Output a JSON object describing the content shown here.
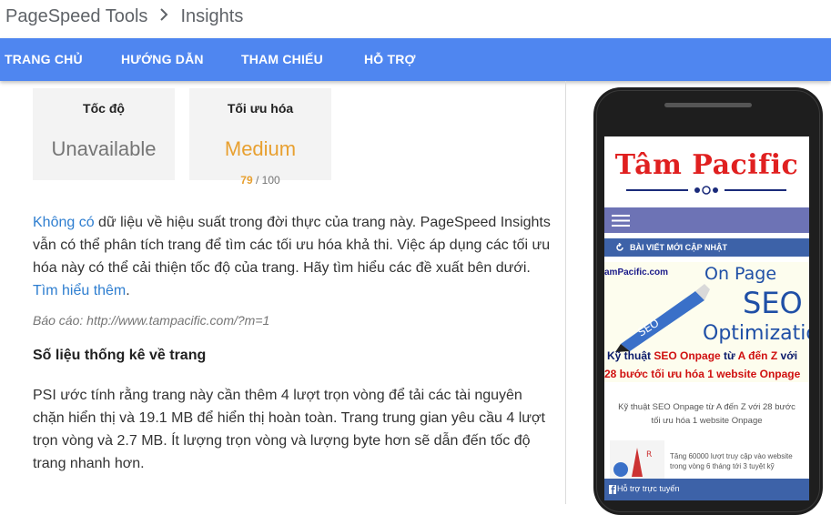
{
  "header": {
    "breadcrumb": [
      "PageSpeed Tools",
      "Insights"
    ]
  },
  "nav": {
    "items": [
      "TRANG CHỦ",
      "HƯỚNG DẪN",
      "THAM CHIẾU",
      "HỖ TRỢ"
    ]
  },
  "cards": {
    "speed": {
      "title": "Tốc độ",
      "value": "Unavailable"
    },
    "optimization": {
      "title": "Tối ưu hóa",
      "value": "Medium",
      "score": "79",
      "max": "/ 100"
    }
  },
  "body": {
    "intro_link1": "Không có",
    "intro_text": " dữ liệu về hiệu suất trong đời thực của trang này. PageSpeed Insights vẫn có thể phân tích trang để tìm các tối ưu hóa khả thi. Việc áp dụng các tối ưu hóa này có thể cải thiện tốc độ của trang. Hãy tìm hiểu các đề xuất bên dưới. ",
    "intro_link2": "Tìm hiểu thêm",
    "intro_end": ".",
    "report": "Báo cáo: http://www.tampacific.com/?m=1",
    "stats_heading": "Số liệu thống kê về trang",
    "stats_text": "PSI ước tính rằng trang này cần thêm 4 lượt trọn vòng để tải các tài nguyên chặn hiển thị và 19.1 MB để hiển thị hoàn toàn. Trang trung gian yêu cầu 4 lượt trọn vòng và 2.7 MB. Ít lượng trọn vòng và lượng byte hơn sẽ dẫn đến tốc độ trang nhanh hơn."
  },
  "preview": {
    "logo": "Tâm Pacific",
    "section_label": "BÀI VIẾT MỚI CẬP NHẬT",
    "banner_url": "amPacific.com",
    "banner_onpage": "On Page",
    "banner_seo": "SEO",
    "banner_opt": "Optimizatio",
    "banner_line1_a": "Kỹ thuật ",
    "banner_line1_b": "SEO Onpage",
    "banner_line1_c": " từ ",
    "banner_line1_d": "A đến Z",
    "banner_line1_e": " với",
    "banner_line2": "28 bước tối ưu hóa 1 website Onpage",
    "caption": "Kỹ thuật SEO Onpage từ A đến Z với 28 bước tối ưu hóa 1 website Onpage",
    "thumb_text": "Tăng 60000 lượt truy cập vào website trong vòng 6 tháng tới 3 tuyệt kỹ",
    "chat_label": "Hỗ trợ trực tuyến"
  },
  "colors": {
    "nav": "#4f86f0",
    "medium": "#e8a030",
    "link": "#2e7ed0"
  }
}
